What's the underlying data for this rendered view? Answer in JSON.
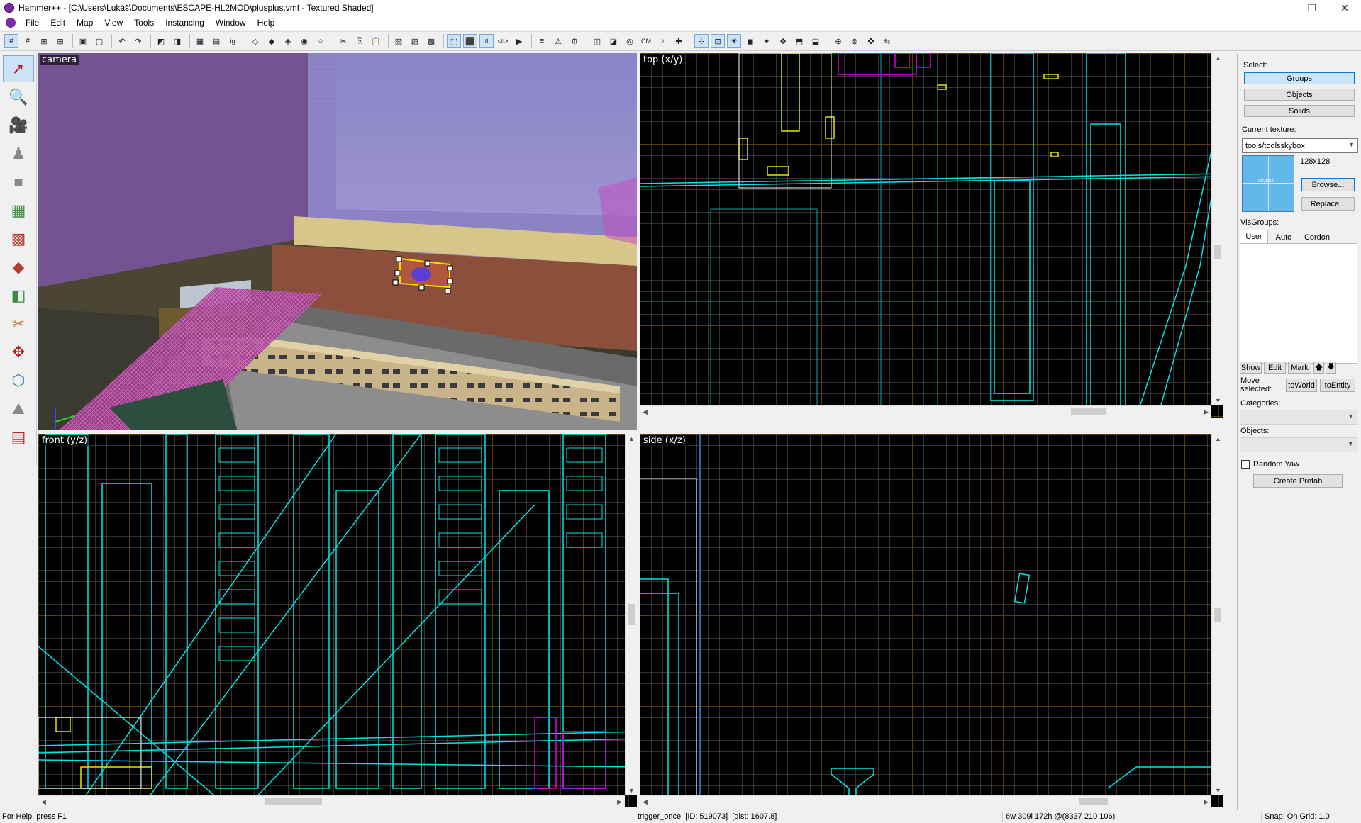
{
  "window": {
    "title": "Hammer++ - [C:\\Users\\Lukáš\\Documents\\ESCAPE-HL2MOD\\plusplus.vmf - Textured Shaded]",
    "minimize": "—",
    "maximize": "❐",
    "close": "✕",
    "mdi_minimize": "–",
    "mdi_restore": "❐",
    "mdi_close": "✕"
  },
  "menu": [
    "File",
    "Edit",
    "Map",
    "View",
    "Tools",
    "Instancing",
    "Window",
    "Help"
  ],
  "toolbar": {
    "buttons": [
      "grid-toggle",
      "grid-3d",
      "grid-smaller",
      "grid-larger",
      "sep",
      "group",
      "ungroup",
      "sep",
      "undo",
      "redo",
      "sep",
      "carve",
      "hollow",
      "sep",
      "texture-lock",
      "texture-app",
      "ig",
      "sep",
      "hide-selected",
      "hide-unselected",
      "show-all",
      "visgroup",
      "quick-hide",
      "sep",
      "cut",
      "copy",
      "paste",
      "sep",
      "tool-vertex",
      "tool-clip",
      "tool-block",
      "sep",
      "select-bbox",
      "select-handle",
      "tl",
      "tb",
      "run-map",
      "sep",
      "entity-report",
      "check-problems",
      "compile",
      "sep",
      "cordon",
      "edit-cordon",
      "cubemaps",
      "cm",
      "sound-tool",
      "entity-helpers",
      "sep",
      "snap",
      "grid-snap",
      "texlight",
      "models",
      "particles",
      "decals",
      "overlays",
      "instances",
      "sep",
      "portal",
      "nodes",
      "navmesh",
      "split"
    ],
    "cm_label": "CM",
    "tl_label": "tl",
    "tb_label": "<tl>",
    "ig_label": "ig"
  },
  "toolbox": {
    "tools": [
      "selection-tool",
      "magnify-tool",
      "camera-tool",
      "entity-tool",
      "block-tool",
      "texture-tool",
      "apply-texture-tool",
      "decal-tool",
      "overlay-tool",
      "clip-tool",
      "vertex-tool",
      "path-tool",
      "displacement-tool",
      "cordon-tool"
    ]
  },
  "viewports": {
    "camera": "camera",
    "top": "top (x/y)",
    "front": "front (y/z)",
    "side": "side (x/z)"
  },
  "right_panel": {
    "select_label": "Select:",
    "select_buttons": [
      "Groups",
      "Objects",
      "Solids"
    ],
    "selected_mode": "Groups",
    "current_texture_label": "Current texture:",
    "current_texture": "tools/toolsskybox",
    "texture_size": "128x128",
    "texture_preview_text": "skybox",
    "browse": "Browse...",
    "replace": "Replace...",
    "visgroups_label": "VisGroups:",
    "visgroup_tabs": [
      "User",
      "Auto",
      "Cordon"
    ],
    "visgroup_buttons": [
      "Show",
      "Edit",
      "Mark"
    ],
    "move_selected_label": "Move selected:",
    "to_world": "toWorld",
    "to_entity": "toEntity",
    "categories_label": "Categories:",
    "objects_label": "Objects:",
    "random_yaw": "Random Yaw",
    "create_prefab": "Create Prefab"
  },
  "status": {
    "help": "For Help, press F1",
    "selection": "trigger_once  [ID: 519073]  [dist: 1607.8]",
    "size": "6w 309l 172h @(8337 210 106)",
    "snap": "Snap: On Grid: 1.0"
  },
  "colors": {
    "wire_cyan": "#00e5e5",
    "wire_yellow": "#e5e500",
    "wire_magenta": "#e000e0",
    "grid_minor": "#5a5a5a",
    "grid_major": "#6e3c00",
    "sky_purple": "#8a84c8",
    "selected_blue": "#cce4f7"
  }
}
